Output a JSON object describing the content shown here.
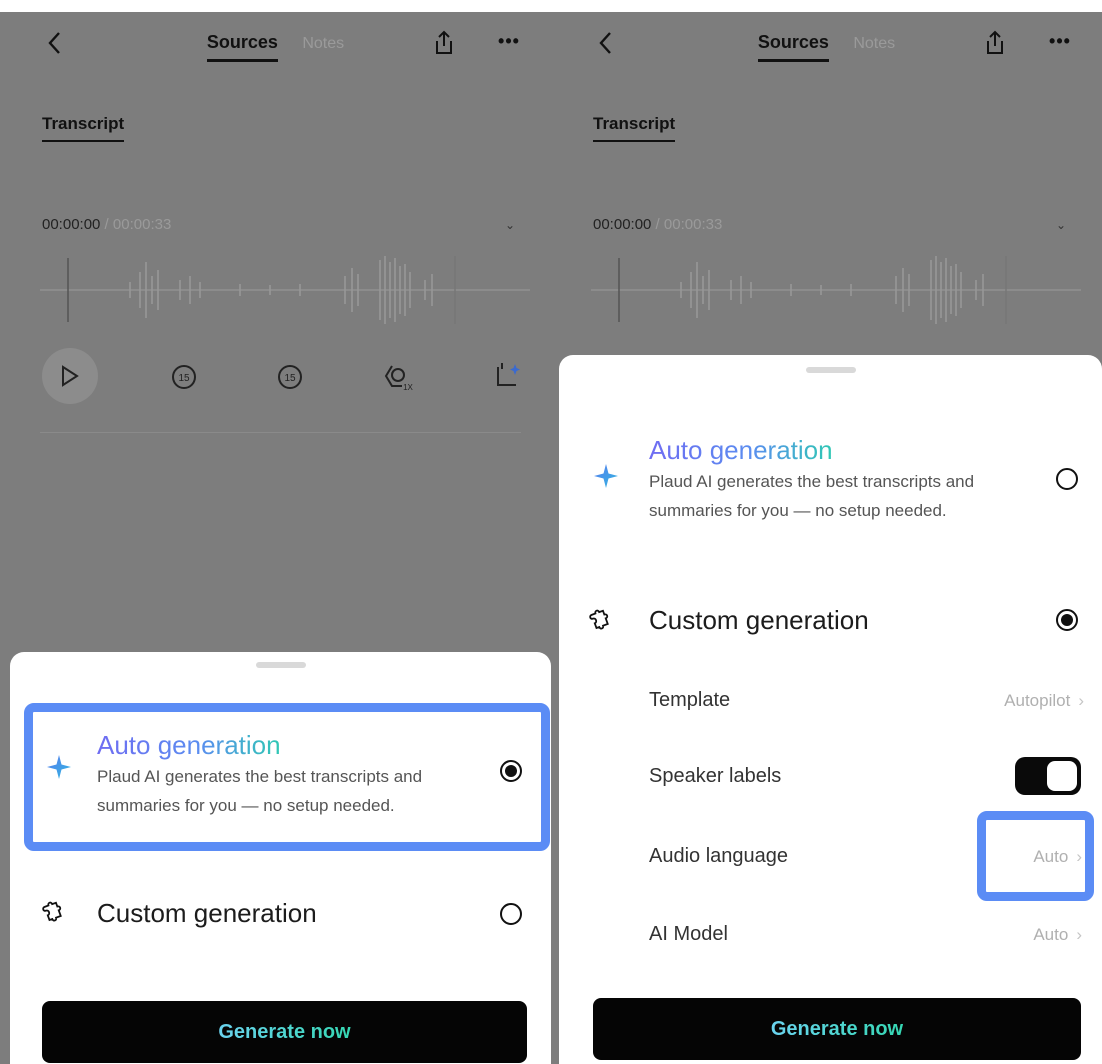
{
  "header": {
    "tab_sources": "Sources",
    "tab_notes": "Notes",
    "sub_tab": "Transcript"
  },
  "player": {
    "current_time": "00:00:00",
    "separator": " / ",
    "total_time": "00:00:33",
    "skip_back_label": "15",
    "skip_forward_label": "15",
    "speed_label": "1X"
  },
  "sheet": {
    "auto": {
      "title": "Auto generation",
      "description": "Plaud AI generates the best transcripts and summaries for you — no setup needed."
    },
    "custom": {
      "title": "Custom generation"
    },
    "settings": {
      "template": {
        "label": "Template",
        "value": "Autopilot"
      },
      "speaker_labels": {
        "label": "Speaker labels",
        "enabled": true
      },
      "audio_language": {
        "label": "Audio language",
        "value": "Auto"
      },
      "ai_model": {
        "label": "AI Model",
        "value": "Auto"
      }
    },
    "generate_button": "Generate now"
  },
  "left_state": {
    "selected": "auto"
  },
  "right_state": {
    "selected": "custom"
  },
  "colors": {
    "highlight": "#5b8cf5",
    "auto_gradient": [
      "#6f6cf2",
      "#2fc8b4"
    ],
    "generate_text_gradient": [
      "#6bd4f0",
      "#35d7b3"
    ],
    "overlay": "#7d7d7d"
  },
  "icons": [
    "back-chevron-icon",
    "share-icon",
    "more-dots-icon",
    "play-icon",
    "rewind-15-icon",
    "forward-15-icon",
    "playback-speed-icon",
    "trim-ai-icon",
    "sparkle-icon",
    "puzzle-icon",
    "chevron-right-icon",
    "chevron-down-icon"
  ]
}
